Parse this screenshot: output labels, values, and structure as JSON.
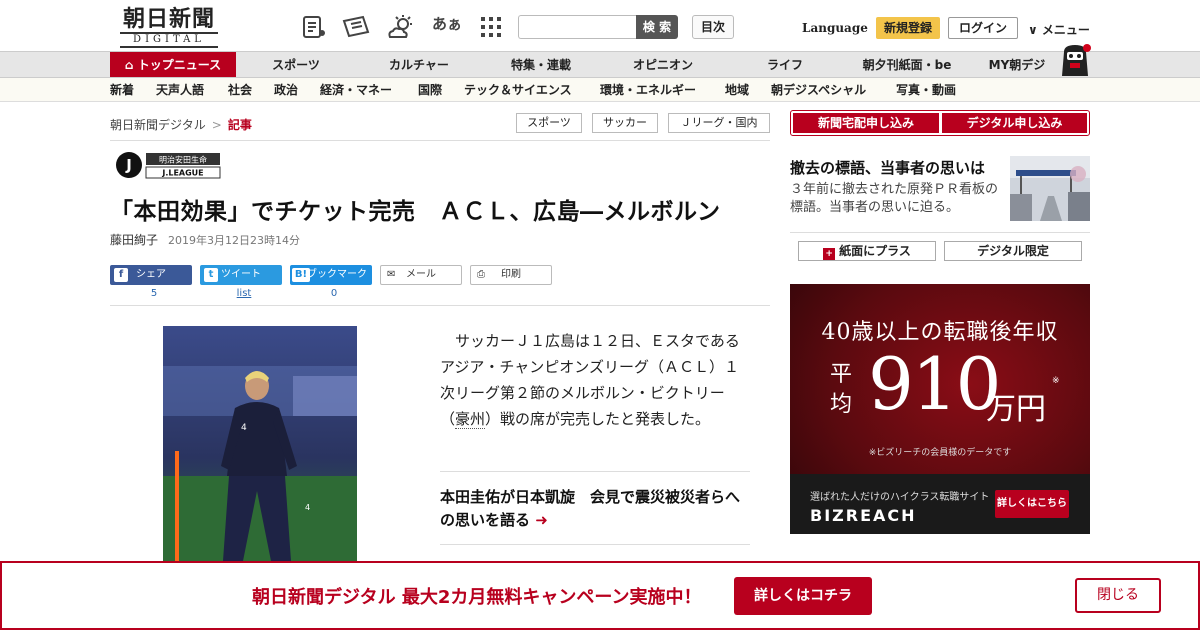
{
  "header": {
    "logo_jp": "朝日新聞",
    "logo_en": "DIGITAL",
    "icons": [
      "paper-icon",
      "ticket-icon",
      "weather-icon",
      "font-size-icon",
      "grid-icon"
    ],
    "font_icon_text": "あぁ",
    "search_placeholder": "",
    "search_button": "検 索",
    "contents_button": "目次",
    "language": "Language",
    "register": "新規登録",
    "login": "ログイン",
    "menu": "∨ メニュー"
  },
  "nav_primary": [
    "トップニュース",
    "スポーツ",
    "カルチャー",
    "特集・連載",
    "オピニオン",
    "ライフ",
    "朝夕刊紙面・be",
    "MY朝デジ"
  ],
  "nav_secondary": [
    "新着",
    "天声人語",
    "社会",
    "政治",
    "経済・マネー",
    "国際",
    "テック＆サイエンス",
    "環境・エネルギー",
    "地域",
    "朝デジスペシャル",
    "写真・動画"
  ],
  "breadcrumb": {
    "home": "朝日新聞デジタル",
    "sep": ">",
    "current": "記事"
  },
  "tags": [
    "スポーツ",
    "サッカー",
    "Ｊリーグ・国内"
  ],
  "article": {
    "sponsor_text": "明治安田生命",
    "league_text": "J.LEAGUE",
    "title": "「本田効果」でチケット完売　ＡＣＬ、広島―メルボルン",
    "author": "藤田絢子",
    "date": "2019年3月12日23時14分",
    "share": [
      {
        "label": "シェア",
        "icon": "f",
        "count": "5",
        "color": "#3b5998"
      },
      {
        "label": "ツイート",
        "icon": "t",
        "count": "list",
        "color": "#2b9ae0"
      },
      {
        "label": "ブックマーク",
        "icon": "B!",
        "count": "0",
        "color": "#1d8fe0"
      }
    ],
    "mail": "メール",
    "print": "印刷",
    "body_before": "　サッカーＪ１広島は１２日、Ｅスタであるアジア・チャンピオンズリーグ（ＡＣＬ）１次リーグ第２節のメルボルン・ビクトリー（",
    "body_link": "豪州",
    "body_after": "）戦の席が完売したと発表した。",
    "related": "本田圭佑が日本凱旋　会見で震災被災者らへの思いを語る",
    "related_arrow": "➜"
  },
  "sidebar": {
    "btn_home": "新聞宅配申し込み",
    "btn_digital": "デジタル申し込み",
    "feature_title": "撤去の標語、当事者の思いは",
    "feature_desc": "３年前に撤去された原発ＰＲ看板の標語。当事者の思いに迫る。",
    "paper_plus": "紙面にプラス",
    "digital_only": "デジタル限定"
  },
  "ad": {
    "headline": "40歳以上の転職後年収",
    "avg": "平均",
    "amount": "910",
    "unit": "万円",
    "mark": "※",
    "note": "※ビズリーチの会員様のデータです",
    "sub": "選ばれた人だけのハイクラス転職サイト",
    "brand": "BIZREACH",
    "cta": "詳しくはこちら"
  },
  "banner": {
    "message": "朝日新聞デジタル 最大2カ月無料キャンペーン実施中！",
    "detail": "詳しくはコチラ",
    "close": "閉じる"
  },
  "colors": {
    "brand_red": "#b8001e",
    "nav_bg": "#e6e6e6",
    "register_yellow": "#f3c44a"
  }
}
